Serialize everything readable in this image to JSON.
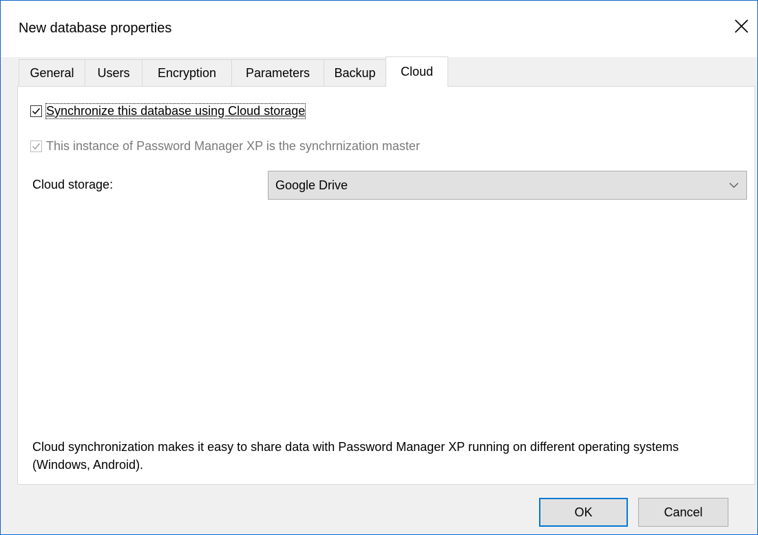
{
  "window": {
    "title": "New database properties",
    "close_icon": "close-icon"
  },
  "tabs": [
    {
      "label": "General"
    },
    {
      "label": "Users"
    },
    {
      "label": "Encryption"
    },
    {
      "label": "Parameters"
    },
    {
      "label": "Backup"
    },
    {
      "label": "Cloud",
      "active": true
    }
  ],
  "cloud": {
    "sync_checkbox": {
      "label": "Synchronize this database using Cloud storage",
      "checked": true
    },
    "master_checkbox": {
      "label": "This instance of Password Manager XP is the synchrnization master",
      "checked": true,
      "disabled": true
    },
    "storage_label": "Cloud storage:",
    "storage_value": "Google Drive",
    "description": "Cloud synchronization makes it easy to share data with Password Manager XP running on different operating systems (Windows, Android)."
  },
  "buttons": {
    "ok": "OK",
    "cancel": "Cancel"
  },
  "colors": {
    "accent": "#0078d7",
    "window_border": "#0a64c8",
    "dialog_bg": "#f0f0f0"
  }
}
